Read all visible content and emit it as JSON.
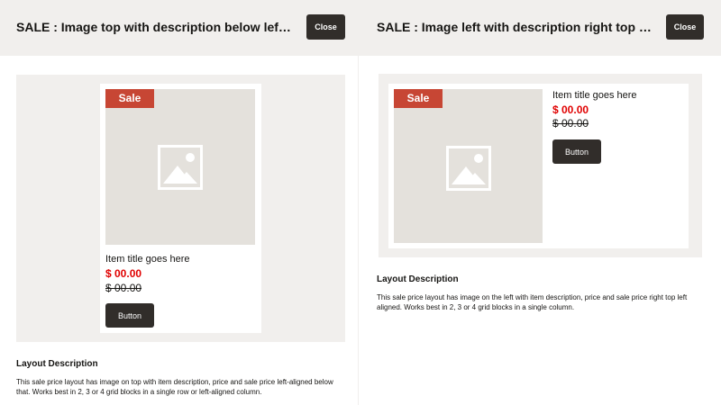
{
  "left_panel": {
    "header_title": "SALE : Image top with description below left aligned",
    "close_label": "Close",
    "badge": "Sale",
    "item_title": "Item title goes here",
    "sale_price": "$ 00.00",
    "original_price": "$ 00.00",
    "button_label": "Button",
    "description_heading": "Layout Description",
    "description_text": "This sale price layout has image on top with item description, price and sale price left-aligned below that. Works best in 2, 3 or 4 grid blocks in a single row or left-aligned column."
  },
  "right_panel": {
    "header_title": "SALE : Image left with description right top left aligned",
    "close_label": "Close",
    "badge": "Sale",
    "item_title": "Item title goes here",
    "sale_price": "$ 00.00",
    "original_price": "$ 00.00",
    "button_label": "Button",
    "description_heading": "Layout Description",
    "description_text": "This sale price layout has image on the left with item description, price and sale price right top left aligned. Works best in 2, 3 or 4 grid blocks in a single column."
  },
  "icons": {
    "image_placeholder": "image-placeholder-icon"
  },
  "colors": {
    "header_bg": "#f1efed",
    "sale_badge": "#c74634",
    "sale_price": "#e00000",
    "button_bg": "#312d2a",
    "image_placeholder_bg": "#e4e1dc"
  }
}
